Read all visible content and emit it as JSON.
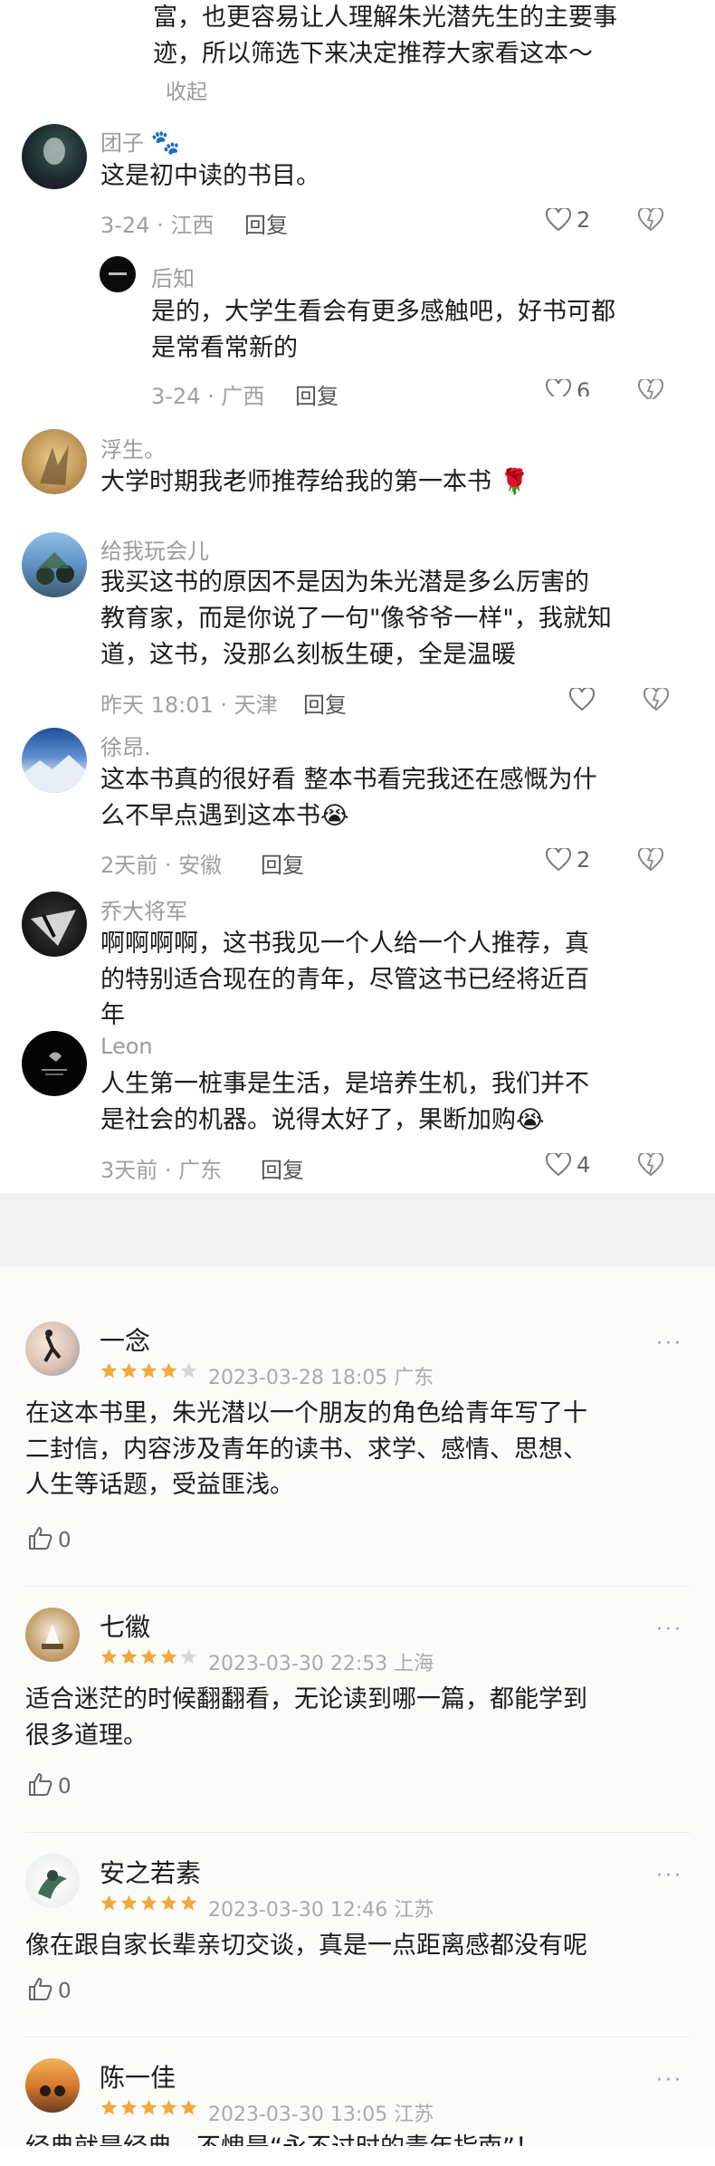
{
  "comments": [
    {
      "lines": [
        "富，也更容易让人理解朱光潜先生的主要事",
        "迹，所以筛选下来决定推荐大家看这本～"
      ],
      "collapse": "收起"
    },
    {
      "name": "团子",
      "name_suffix": "🐾",
      "lines": [
        "这是初中读的书目。"
      ],
      "meta": "3-24 · 江西",
      "reply": "回复",
      "likes": "2"
    },
    {
      "name": "后知",
      "lines": [
        "是的，大学生看会有更多感触吧，好书可都",
        "是常看常新的"
      ],
      "meta": "3-24 · 广西",
      "reply": "回复",
      "likes": "6"
    },
    {
      "name": "浮生。",
      "lines": [
        "大学时期我老师推荐给我的第一本书 🌹"
      ]
    },
    {
      "name": "给我玩会儿",
      "lines": [
        "我买这书的原因不是因为朱光潜是多么厉害的",
        "教育家，而是你说了一句\"像爷爷一样\"，我就知",
        "道，这书，没那么刻板生硬，全是温暖"
      ],
      "meta": "昨天 18:01 · 天津",
      "reply": "回复",
      "likes": ""
    },
    {
      "name": "徐昂.",
      "lines": [
        "这本书真的很好看 整本书看完我还在感慨为什",
        "么不早点遇到这本书😭"
      ],
      "meta": "2天前 · 安徽",
      "reply": "回复",
      "likes": "2"
    },
    {
      "name": "乔大将军",
      "lines": [
        "啊啊啊啊，这书我见一个人给一个人推荐，真",
        "的特别适合现在的青年，尽管这书已经将近百",
        "年"
      ]
    },
    {
      "name": "Leon",
      "lines": [
        "人生第一桩事是生活，是培养生机，我们并不",
        "是社会的机器。说得太好了，果断加购😭"
      ],
      "meta": "3天前 · 广东",
      "reply": "回复",
      "likes": "4"
    }
  ],
  "reviews": [
    {
      "name": "一念",
      "rating": 4,
      "meta": "2023-03-28 18:05 广东",
      "lines": [
        "在这本书里，朱光潜以一个朋友的角色给青年写了十",
        "二封信，内容涉及青年的读书、求学、感情、思想、",
        "人生等话题，受益匪浅。"
      ],
      "likes": "0",
      "more": "···"
    },
    {
      "name": "七徽",
      "rating": 4,
      "meta": "2023-03-30 22:53 上海",
      "lines": [
        "适合迷茫的时候翻翻看，无论读到哪一篇，都能学到",
        "很多道理。"
      ],
      "likes": "0",
      "more": "···"
    },
    {
      "name": "安之若素",
      "rating": 5,
      "meta": "2023-03-30 12:46 江苏",
      "lines": [
        "像在跟自家长辈亲切交谈，真是一点距离感都没有呢"
      ],
      "likes": "0",
      "more": "···"
    },
    {
      "name": "陈一佳",
      "rating": 5,
      "meta": "2023-03-30 13:05 江苏",
      "lines": [
        "经典就是经典，不愧是“永不过时的青年指南”！"
      ],
      "likes": "",
      "more": "···"
    }
  ],
  "colors": {
    "star": "#f2a83b",
    "star_empty": "#d8d8d8",
    "meta": "#a0a0a0"
  }
}
